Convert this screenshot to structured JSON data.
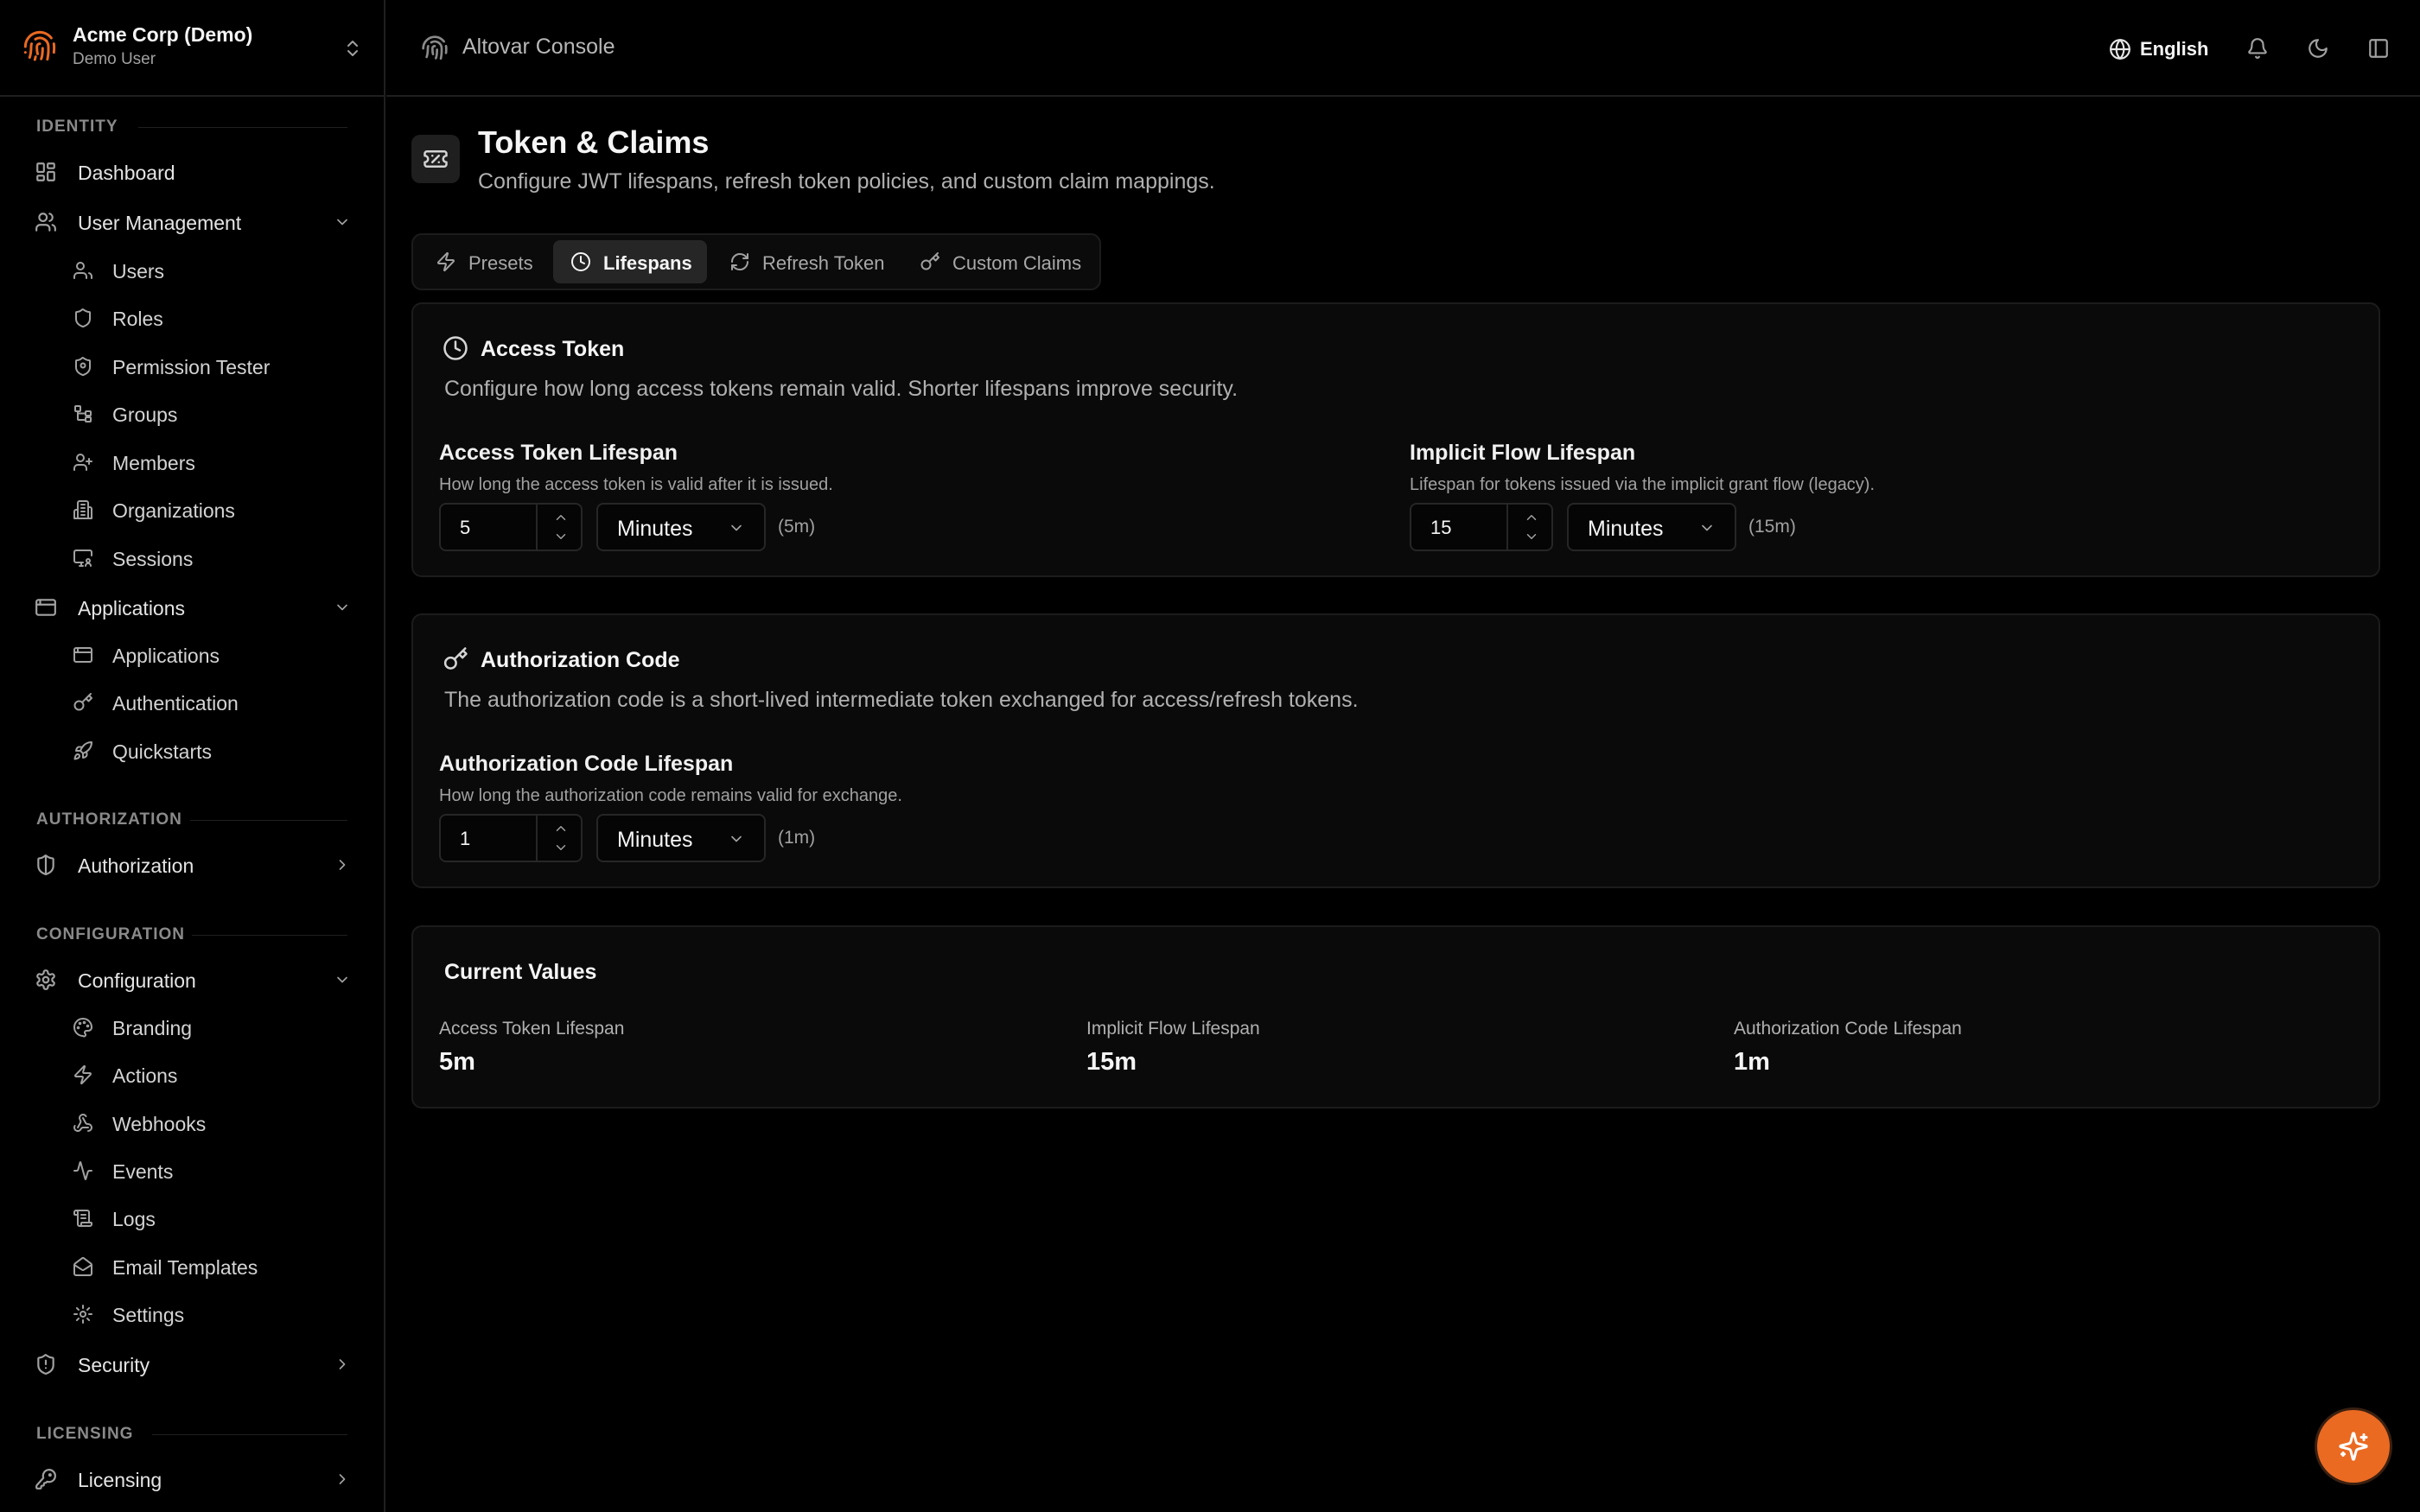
{
  "org": {
    "name": "Acme Corp (Demo)",
    "user": "Demo User"
  },
  "sidebar": {
    "identity_label": "IDENTITY",
    "dashboard": "Dashboard",
    "user_management": "User Management",
    "users": "Users",
    "roles": "Roles",
    "permission_tester": "Permission Tester",
    "groups": "Groups",
    "members": "Members",
    "organizations": "Organizations",
    "sessions": "Sessions",
    "applications_group": "Applications",
    "applications": "Applications",
    "authentication": "Authentication",
    "quickstarts": "Quickstarts",
    "authorization_label": "AUTHORIZATION",
    "authorization": "Authorization",
    "configuration_label": "CONFIGURATION",
    "configuration": "Configuration",
    "branding": "Branding",
    "actions": "Actions",
    "webhooks": "Webhooks",
    "events": "Events",
    "logs": "Logs",
    "email_templates": "Email Templates",
    "settings": "Settings",
    "security": "Security",
    "licensing_label": "LICENSING",
    "licensing": "Licensing"
  },
  "header": {
    "console_title": "Altovar Console",
    "language": "English"
  },
  "page": {
    "title": "Token & Claims",
    "subtitle": "Configure JWT lifespans, refresh token policies, and custom claim mappings."
  },
  "tabs": {
    "presets": "Presets",
    "lifespans": "Lifespans",
    "refresh_token": "Refresh Token",
    "custom_claims": "Custom Claims"
  },
  "access_token": {
    "title": "Access Token",
    "description": "Configure how long access tokens remain valid. Shorter lifespans improve security.",
    "lifespan": {
      "label": "Access Token Lifespan",
      "help": "How long the access token is valid after it is issued.",
      "value": "5",
      "unit": "Minutes",
      "hint": "(5m)"
    },
    "implicit": {
      "label": "Implicit Flow Lifespan",
      "help": "Lifespan for tokens issued via the implicit grant flow (legacy).",
      "value": "15",
      "unit": "Minutes",
      "hint": "(15m)"
    }
  },
  "auth_code": {
    "title": "Authorization Code",
    "description": "The authorization code is a short-lived intermediate token exchanged for access/refresh tokens.",
    "lifespan": {
      "label": "Authorization Code Lifespan",
      "help": "How long the authorization code remains valid for exchange.",
      "value": "1",
      "unit": "Minutes",
      "hint": "(1m)"
    }
  },
  "current_values": {
    "title": "Current Values",
    "access_label": "Access Token Lifespan",
    "access_value": "5m",
    "implicit_label": "Implicit Flow Lifespan",
    "implicit_value": "15m",
    "auth_code_label": "Authorization Code Lifespan",
    "auth_code_value": "1m"
  },
  "colors": {
    "accent": "#ea6a22",
    "background": "#000000",
    "card": "#0a0a0a",
    "border": "#1f1f1f"
  }
}
